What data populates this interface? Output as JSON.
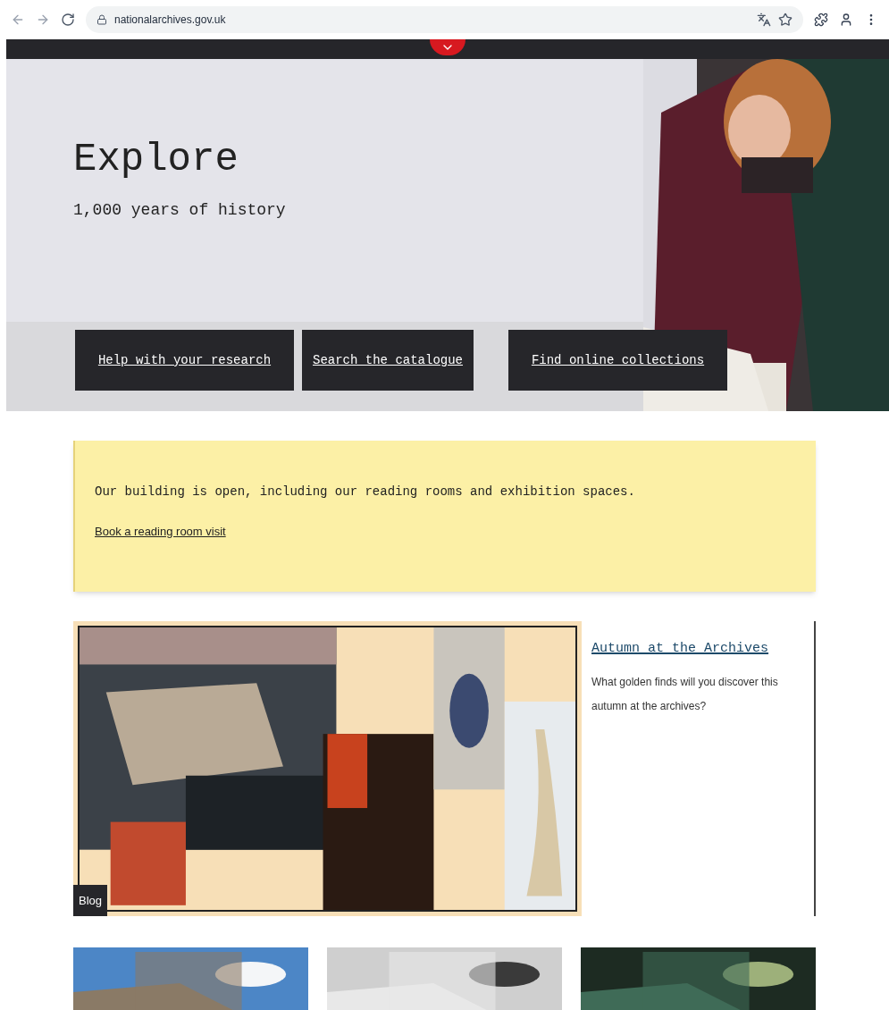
{
  "browser": {
    "url": "nationalarchives.gov.uk"
  },
  "nav": {
    "menu_button": {
      "expanded": false
    }
  },
  "hero": {
    "title": "Explore",
    "subtitle": "1,000 years of history",
    "buttons": [
      {
        "label": "Help with your research"
      },
      {
        "label": "Search the catalogue"
      },
      {
        "label": "Find online collections"
      }
    ]
  },
  "notice": {
    "text": "Our building is open, including our reading rooms and exhibition spaces.",
    "link": "Book a reading room visit"
  },
  "feature": {
    "tag": "Blog",
    "title": "Autumn at the Archives",
    "text": "What golden finds will you discover this autumn at the archives?"
  }
}
